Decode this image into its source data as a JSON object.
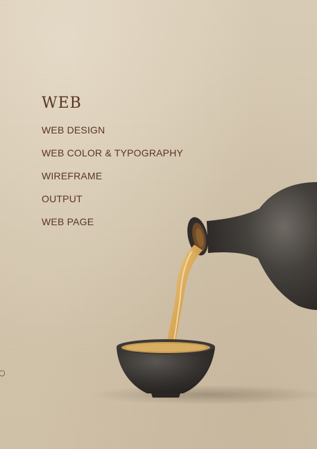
{
  "menu": {
    "title": "WEB",
    "items": [
      {
        "label": "WEB DESIGN"
      },
      {
        "label": "WEB COLOR & TYPOGRAPHY"
      },
      {
        "label": "WIREFRAME"
      },
      {
        "label": "OUTPUT"
      },
      {
        "label": "WEB PAGE"
      }
    ]
  },
  "edge_glyph": "○",
  "colors": {
    "background": "#d6c9b2",
    "text": "#5a3525",
    "pot": "#3b3835",
    "tea": "#d9a653"
  },
  "illustration": {
    "subject-icon": "teapot-pouring-into-cup-icon"
  }
}
